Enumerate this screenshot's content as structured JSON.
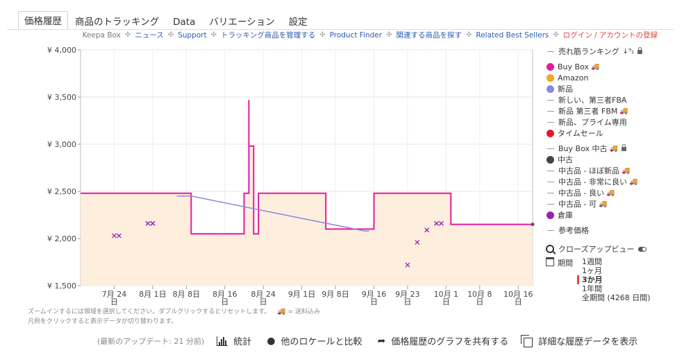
{
  "tabs": [
    "価格履歴",
    "商品のトラッキング",
    "Data",
    "バリエーション",
    "設定"
  ],
  "subnav": [
    "Keepa Box",
    "ニュース",
    "Support",
    "トラッキング商品を管理する",
    "Product Finder",
    "関連する商品を探す",
    "Related Best Sellers",
    "ログイン / アカウントの登録"
  ],
  "subnav_sep": "✣",
  "legend": {
    "sales_rank": "売れ筋ランキング",
    "buybox": "Buy Box",
    "amazon": "Amazon",
    "new": "新品",
    "new_fba": "新しい、第三者FBA",
    "new_fbm": "新品 第三者 FBM",
    "new_prime": "新品、プライム専用",
    "lightning": "タイムセール",
    "buybox_used": "Buy Box 中古",
    "used": "中古",
    "used_like_new": "中古品 - ほぼ新品",
    "used_very_good": "中古品 - 非常に良い",
    "used_good": "中古品 - 良い",
    "used_acceptable": "中古品 - 可",
    "warehouse": "倉庫",
    "reference": "参考価格"
  },
  "colors": {
    "buybox": "#e6199e",
    "amazon": "#f5a623",
    "new": "#8888dd",
    "lightning": "#e01a2a",
    "used": "#444444",
    "warehouse": "#9a22b0",
    "fill": "#fdeede"
  },
  "closeup_label": "クローズアップビュー",
  "period": {
    "label": "期間",
    "options": [
      "1週間",
      "1ヶ月",
      "3か月",
      "1年間",
      "全期間 (4268 日間)"
    ],
    "selected": "3か月"
  },
  "notes": {
    "zoom": "ズームインするには領域を選択してください。ダブルクリックするとリセットします。",
    "shipping_suffix": "= 送料込み",
    "legend_tip": "凡例をクリックすると表示データが切り替わります。"
  },
  "bottom": {
    "updated": "(最新のアップデート: 21 分前)",
    "stats": "統計",
    "compare": "他のロケールと比較",
    "share": "価格履歴のグラフを共有する",
    "details": "詳細な履歴データを表示"
  },
  "chart_data": {
    "type": "line",
    "y_tick_labels": [
      "¥ 4,000",
      "¥ 3,500",
      "¥ 3,000",
      "¥ 2,500",
      "¥ 2,000",
      "¥ 1,500"
    ],
    "y_ticks": [
      4000,
      3500,
      3000,
      2500,
      2000,
      1500
    ],
    "ylim": [
      1500,
      4000
    ],
    "x_range": [
      "2023-07-17",
      "2023-10-19"
    ],
    "x_ticks": [
      {
        "x": "2023-07-24",
        "label": "7月 24",
        "sub": "日"
      },
      {
        "x": "2023-08-01",
        "label": "8月 1日",
        "sub": ""
      },
      {
        "x": "2023-08-08",
        "label": "8月 8日",
        "sub": ""
      },
      {
        "x": "2023-08-16",
        "label": "8月 16",
        "sub": "日"
      },
      {
        "x": "2023-08-24",
        "label": "8月 24",
        "sub": "日"
      },
      {
        "x": "2023-09-01",
        "label": "9月 1日",
        "sub": ""
      },
      {
        "x": "2023-09-08",
        "label": "9月 8日",
        "sub": ""
      },
      {
        "x": "2023-09-16",
        "label": "9月 16",
        "sub": "日"
      },
      {
        "x": "2023-09-23",
        "label": "9月 23",
        "sub": "日"
      },
      {
        "x": "2023-10-01",
        "label": "10月 1",
        "sub": "日"
      },
      {
        "x": "2023-10-08",
        "label": "10月 8",
        "sub": "日"
      },
      {
        "x": "2023-10-16",
        "label": "10月 16",
        "sub": "日"
      }
    ],
    "grid": true,
    "series": [
      {
        "name": "Buy Box",
        "style": "step",
        "points": [
          [
            "2023-07-17",
            2480
          ],
          [
            "2023-08-09",
            2480
          ],
          [
            "2023-08-09",
            2050
          ],
          [
            "2023-08-20",
            2050
          ],
          [
            "2023-08-20",
            2480
          ],
          [
            "2023-08-21",
            2480
          ],
          [
            "2023-08-21",
            3470
          ],
          [
            "2023-08-21",
            2980
          ],
          [
            "2023-08-22",
            2980
          ],
          [
            "2023-08-22",
            2050
          ],
          [
            "2023-08-23",
            2050
          ],
          [
            "2023-08-23",
            2480
          ],
          [
            "2023-09-06",
            2480
          ],
          [
            "2023-09-06",
            2100
          ],
          [
            "2023-09-16",
            2100
          ],
          [
            "2023-09-16",
            2480
          ],
          [
            "2023-10-02",
            2480
          ],
          [
            "2023-10-02",
            2150
          ],
          [
            "2023-10-19",
            2150
          ]
        ]
      },
      {
        "name": "新品",
        "style": "step",
        "points": [
          [
            "2023-08-06",
            2450
          ],
          [
            "2023-08-09",
            2450
          ],
          [
            "2023-09-14",
            2080
          ],
          [
            "2023-09-15",
            2080
          ]
        ]
      },
      {
        "name": "倉庫",
        "style": "marker",
        "points": [
          [
            "2023-07-24",
            2030
          ],
          [
            "2023-07-25",
            2030
          ],
          [
            "2023-07-31",
            2160
          ],
          [
            "2023-08-01",
            2160
          ],
          [
            "2023-08-01",
            2160
          ],
          [
            "2023-09-23",
            1720
          ],
          [
            "2023-09-25",
            1960
          ],
          [
            "2023-09-27",
            2090
          ],
          [
            "2023-09-29",
            2160
          ],
          [
            "2023-09-30",
            2160
          ]
        ]
      }
    ]
  }
}
